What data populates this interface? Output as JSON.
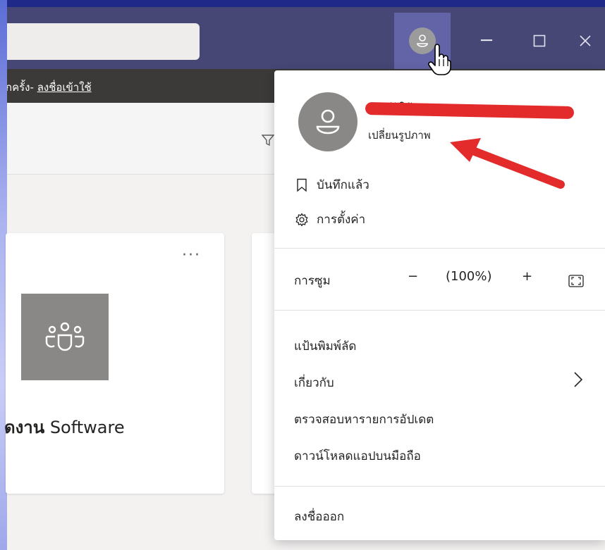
{
  "notice": {
    "text": "กครั้ง- ",
    "link": "ลงชื่อเข้าใช้"
  },
  "window_controls": {
    "minimize": "─",
    "maximize": "☐",
    "close": "✕"
  },
  "card": {
    "more": "···",
    "team_name_bold": "ดงาน",
    "team_name_rest": " Software"
  },
  "profile_menu": {
    "user_name": "บัญชีผู้ใช้",
    "change_photo": "เปลี่ยนรูปภาพ",
    "saved": "บันทึกแล้ว",
    "settings": "การตั้งค่า",
    "zoom_label": "การซูม",
    "zoom_minus": "−",
    "zoom_value": "(100%)",
    "zoom_plus": "+",
    "keyboard_shortcuts": "แป้นพิมพ์ลัด",
    "about": "เกี่ยวกับ",
    "check_updates": "ตรวจสอบหารายการอัปเดต",
    "download_mobile": "ดาวน์โหลดแอปบนมือถือ",
    "sign_out": "ลงชื่อออก"
  },
  "icons": {
    "avatar": "person-avatar-icon",
    "bookmark": "bookmark-icon",
    "settings": "gear-icon",
    "fullscreen": "fullscreen-icon",
    "chevron": "chevron-right-icon",
    "team": "team-icon",
    "filter": "filter-icon"
  },
  "colors": {
    "titlebar": "#464775",
    "avatar_button": "#6264a7",
    "annotation_red": "#e32b2b"
  }
}
